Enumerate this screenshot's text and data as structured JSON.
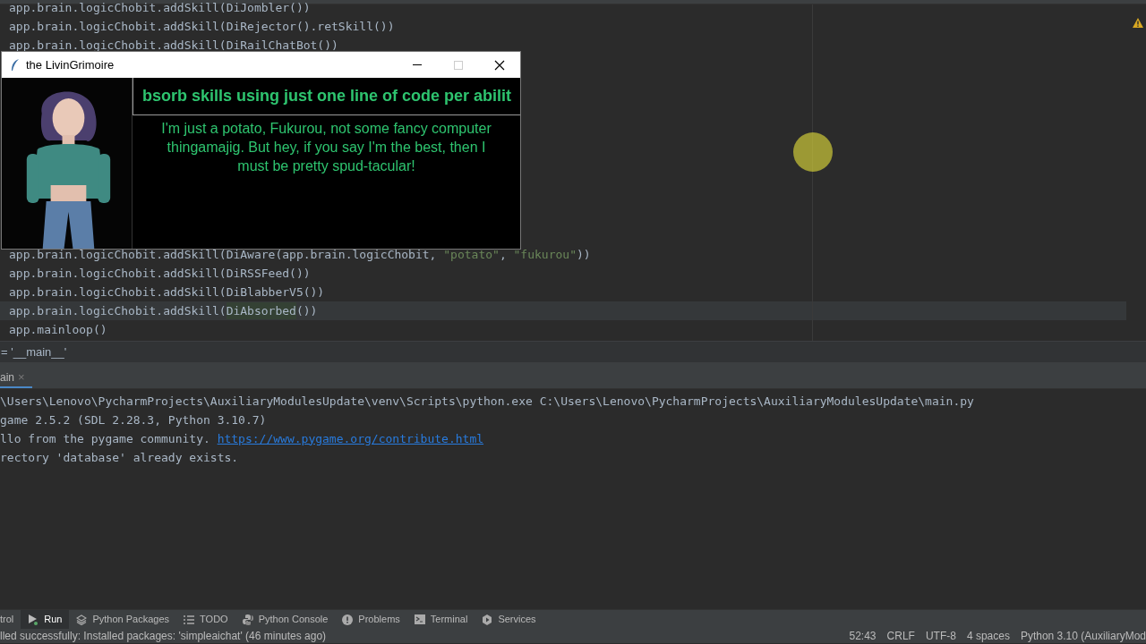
{
  "editor": {
    "lines_above": [
      {
        "parts": [
          {
            "text": "app.brain.logicChobit.addSkill(DiJombler())",
            "kind": "code"
          }
        ],
        "current": false
      },
      {
        "parts": [
          {
            "text": "app.brain.logicChobit.addSkill(DiRejector().retSkill())",
            "kind": "code"
          }
        ],
        "current": false
      },
      {
        "parts": [
          {
            "text": "app.brain.logicChobit.addSkill(DiRailChatBot())",
            "kind": "code"
          }
        ],
        "current": false
      }
    ],
    "lines_below": [
      {
        "parts": [
          {
            "text": "app.brain.logicChobit.addSkill(DiAware(app.brain.logicChobit, ",
            "kind": "code"
          },
          {
            "text": "\"potato\"",
            "kind": "string"
          },
          {
            "text": ", ",
            "kind": "code"
          },
          {
            "text": "\"fukurou\"",
            "kind": "string"
          },
          {
            "text": "))",
            "kind": "code"
          }
        ],
        "current": false
      },
      {
        "parts": [
          {
            "text": "app.brain.logicChobit.addSkill(DiRSSFeed())",
            "kind": "code"
          }
        ],
        "current": false
      },
      {
        "parts": [
          {
            "text": "app.brain.logicChobit.addSkill(DiBlabberV5())",
            "kind": "code"
          }
        ],
        "current": false
      },
      {
        "parts": [
          {
            "text": "app.brain.logicChobit.addSkill(",
            "kind": "code"
          },
          {
            "text": "DiAbsorbed",
            "kind": "highlight"
          },
          {
            "text": "())",
            "kind": "code"
          }
        ],
        "current": true
      },
      {
        "parts": [
          {
            "text": "app.mainloop()",
            "kind": "code"
          }
        ],
        "current": false
      }
    ],
    "breadcrumb": "= '__main__'"
  },
  "app_window": {
    "title": "the LivinGrimoire",
    "banner": "bsorb skills using just one line of code per abilit",
    "message": "I'm just a potato, Fukurou, not some fancy computer thingamajig. But hey, if you say I'm the best, then I must be pretty spud-tacular!"
  },
  "run_tab": {
    "label": "ain",
    "close": "×"
  },
  "console": [
    {
      "parts": [
        {
          "text": "\\Users\\Lenovo\\PycharmProjects\\AuxiliaryModulesUpdate\\venv\\Scripts\\python.exe C:\\Users\\Lenovo\\PycharmProjects\\AuxiliaryModulesUpdate\\main.py",
          "kind": "text"
        }
      ]
    },
    {
      "parts": [
        {
          "text": "game 2.5.2 (SDL 2.28.3, Python 3.10.7)",
          "kind": "text"
        }
      ]
    },
    {
      "parts": [
        {
          "text": "llo from the pygame community. ",
          "kind": "text"
        },
        {
          "text": "https://www.pygame.org/contribute.html",
          "kind": "link"
        }
      ]
    },
    {
      "parts": [
        {
          "text": "rectory 'database' already exists.",
          "kind": "text"
        }
      ]
    }
  ],
  "tool_tabs": [
    {
      "label": "trol",
      "kind": "plain",
      "selected": false
    },
    {
      "label": "Run",
      "kind": "run",
      "selected": true
    },
    {
      "label": "Python Packages",
      "kind": "packages",
      "selected": false
    },
    {
      "label": "TODO",
      "kind": "todo",
      "selected": false
    },
    {
      "label": "Python Console",
      "kind": "console",
      "selected": false
    },
    {
      "label": "Problems",
      "kind": "problems",
      "selected": false
    },
    {
      "label": "Terminal",
      "kind": "terminal",
      "selected": false
    },
    {
      "label": "Services",
      "kind": "services",
      "selected": false
    }
  ],
  "status_bar": {
    "message": "lled successfully: Installed packages: 'simpleaichat' (46 minutes ago)",
    "items": [
      "52:43",
      "CRLF",
      "UTF-8",
      "4 spaces",
      "Python 3.10 (AuxiliaryMod"
    ]
  }
}
